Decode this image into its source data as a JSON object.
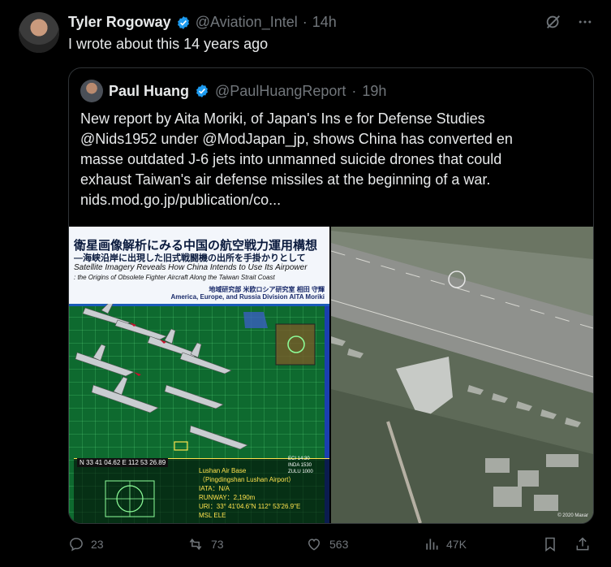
{
  "tweet": {
    "author_name": "Tyler Rogoway",
    "author_handle": "@Aviation_Intel",
    "separator": "·",
    "time": "14h",
    "text": "I wrote about this 14 years ago"
  },
  "quoted": {
    "author_name": "Paul Huang",
    "author_handle": "@PaulHuangReport",
    "separator": "·",
    "time": "19h",
    "lines": [
      "New report by Aita Moriki, of Japan's Ins      e for Defense Studies",
      "@Nids1952 under @ModJapan_jp, shows China has converted en",
      "masse outdated J-6 jets into unmanned suicide drones that could",
      "exhaust Taiwan's air defense missiles at the beginning of a war.",
      "nids.mod.go.jp/publication/co..."
    ]
  },
  "report_image": {
    "title_jp": "衛星画像解析にみる中国の航空戦力運用構想",
    "subtitle_jp": "—海峡沿岸に出現した旧式戦闘機の出所を手掛かりとして",
    "title_en": "Satellite Imagery Reveals How China Intends to Use Its Airpower",
    "subtitle_en": ": the Origins of Obsolete Fighter Aircraft Along the Taiwan Strait Coast",
    "affiliation_jp": "地域研究部  米欧ロシア研究室  相田  守輝",
    "affiliation_en": "America, Europe, and Russia Division  AITA Moriki",
    "coord": "N 33 41 04.62 E 112 53 26.89",
    "airbase_lines": [
      "Lushan Air Base",
      "（Pingdingshan Lushan Airport）",
      "IATA：N/A",
      "RUNWAY：2,190m",
      "URI：33° 41'04.6\"N  112° 53'26.9\"E",
      "MSL ELE"
    ],
    "legend_lines": [
      "ECI 14:30",
      "INDA 1530",
      "ZULU 1000"
    ]
  },
  "satellite_image": {
    "copyright": "© 2020 Maxar"
  },
  "actions": {
    "replies": "23",
    "reposts": "73",
    "likes": "563",
    "views": "47K"
  },
  "colors": {
    "verified": "#1d9bf0",
    "muted": "#71767b",
    "border": "#2f3336"
  }
}
